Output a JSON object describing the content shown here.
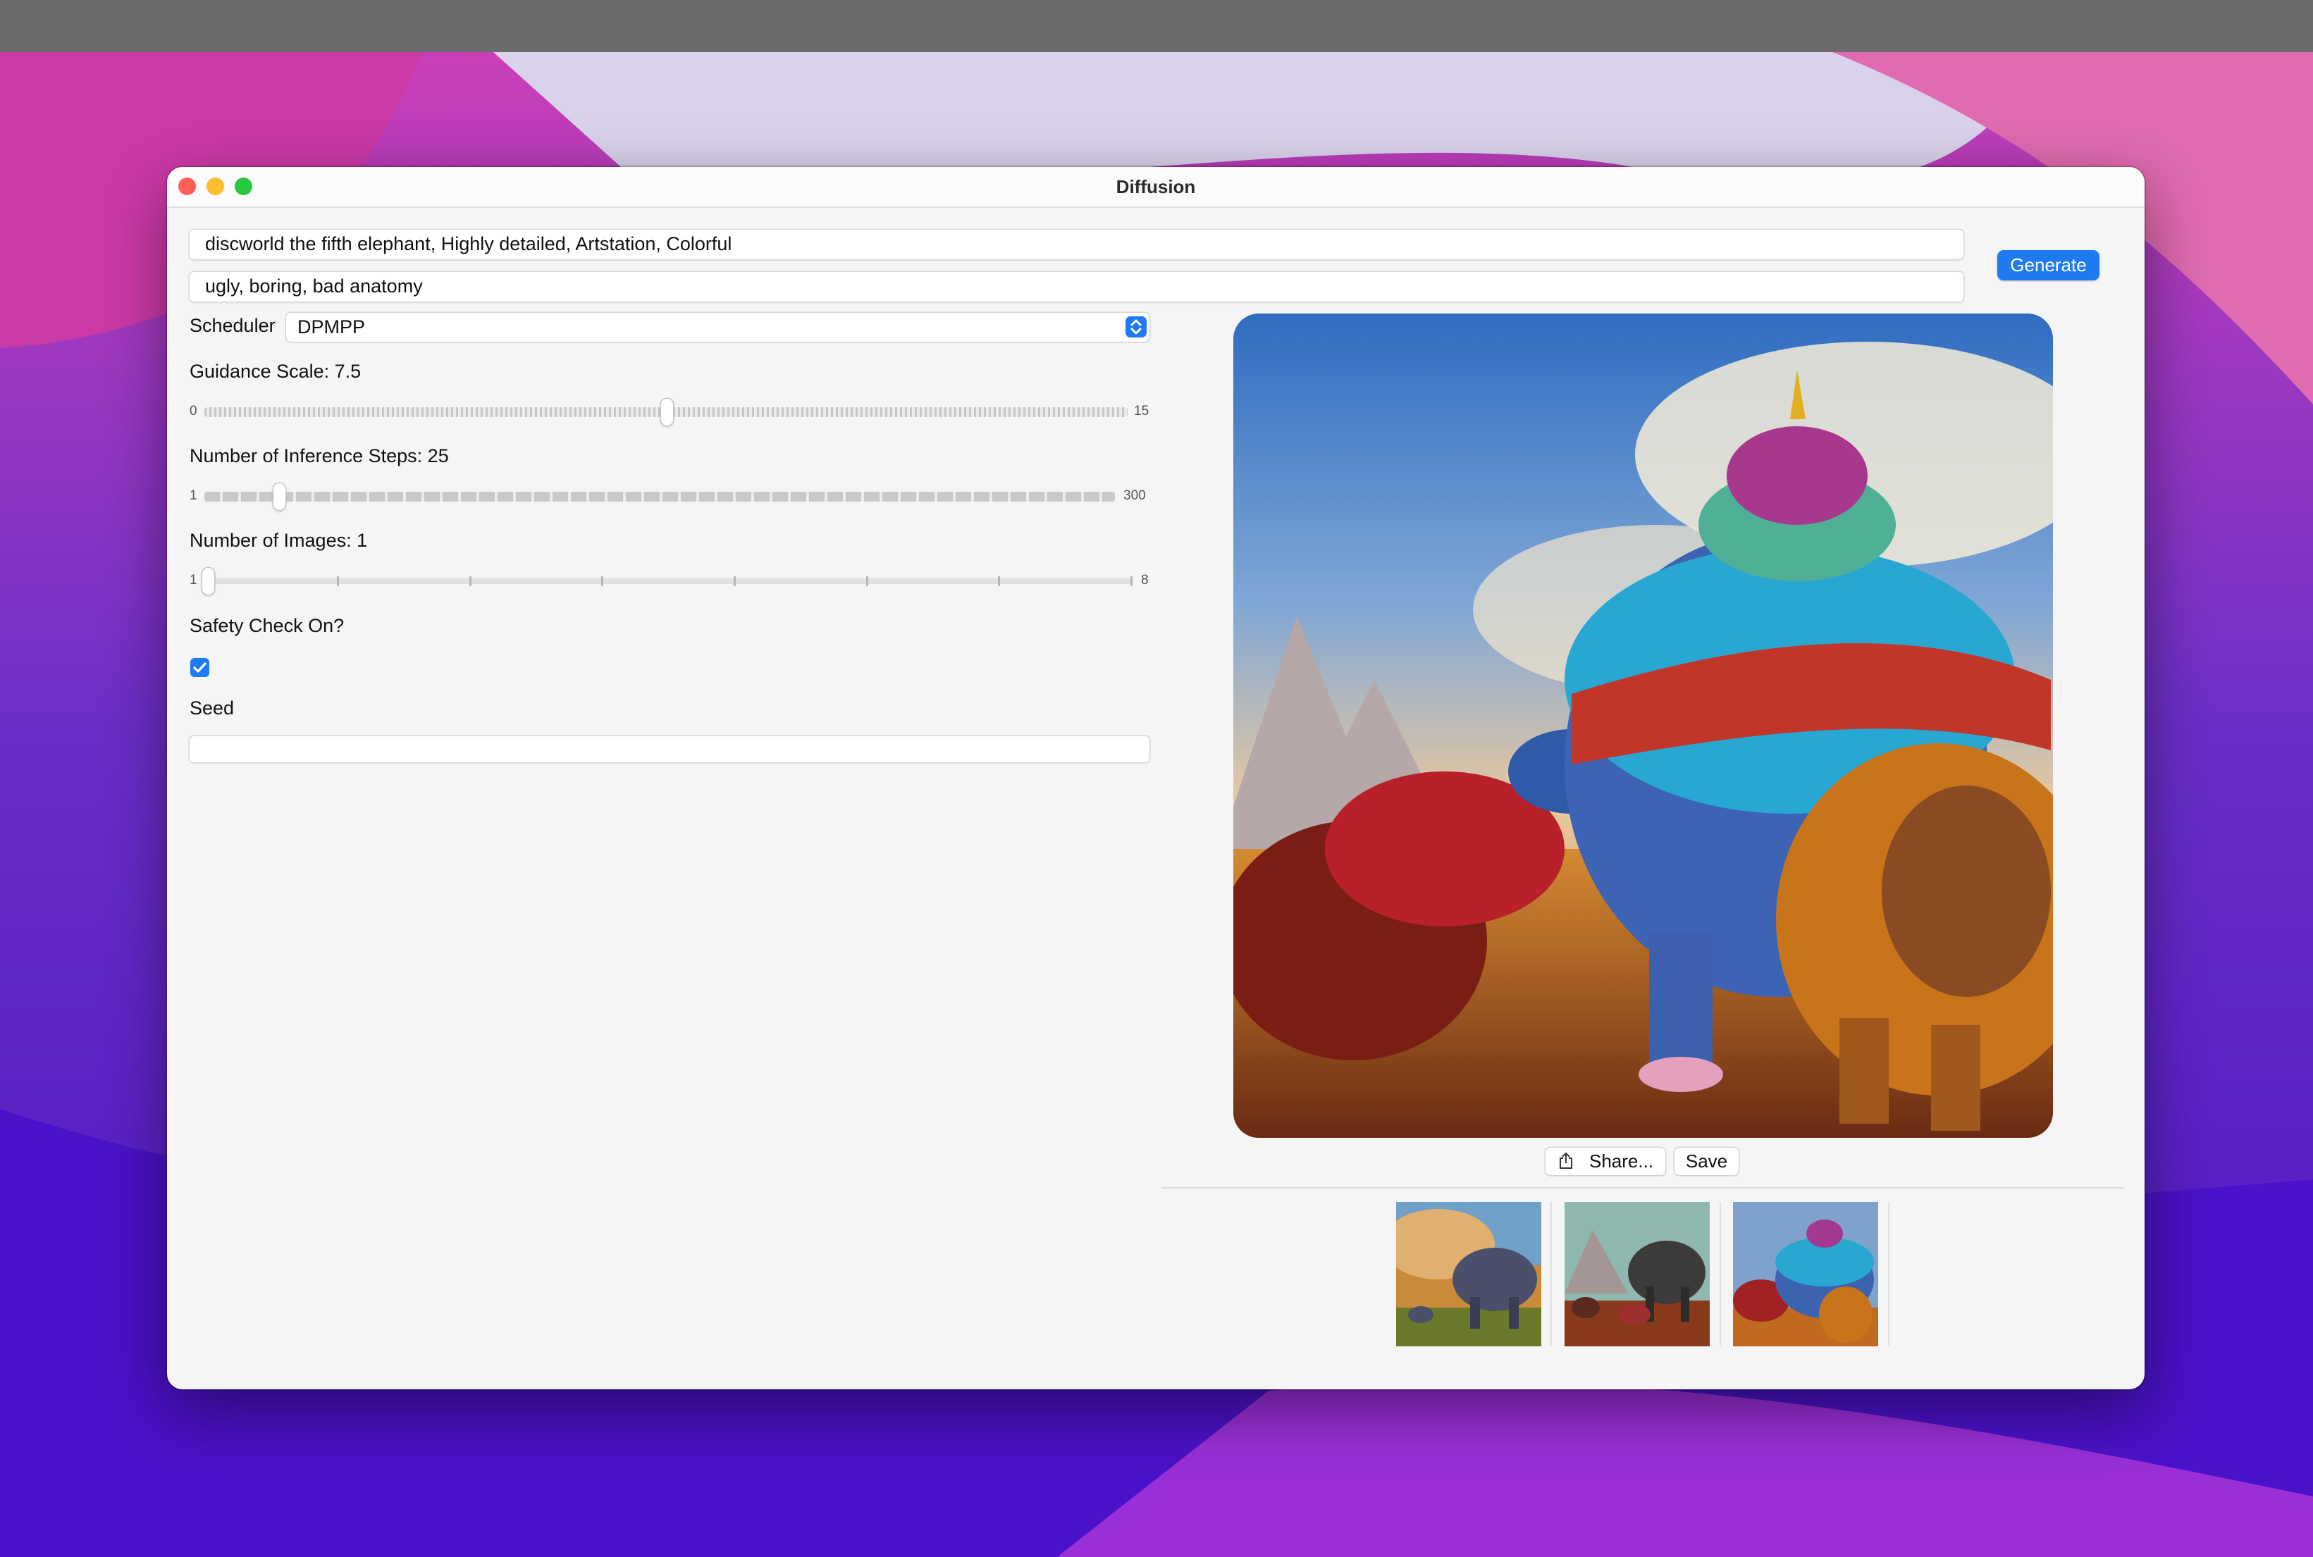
{
  "window": {
    "title": "Diffusion"
  },
  "prompt": {
    "value": "discworld the fifth elephant, Highly detailed, Artstation, Colorful"
  },
  "negative_prompt": {
    "value": "ugly, boring, bad anatomy"
  },
  "generate": {
    "label": "Generate"
  },
  "scheduler": {
    "label": "Scheduler",
    "value": "DPMPP"
  },
  "guidance": {
    "label": "Guidance Scale: 7.5",
    "min": "0",
    "max": "15",
    "value": 7.5
  },
  "steps": {
    "label": "Number of Inference Steps: 25",
    "min": "1",
    "max": "300",
    "value": 25
  },
  "images": {
    "label": "Number of Images: 1",
    "min": "1",
    "max": "8",
    "value": 1
  },
  "safety": {
    "label": "Safety Check On?",
    "checked": true
  },
  "seed": {
    "label": "Seed",
    "value": ""
  },
  "actions": {
    "share": "Share...",
    "save": "Save"
  },
  "colors": {
    "accent": "#1f7bf2",
    "close": "#fe5f57",
    "minimize": "#febc2e",
    "zoom": "#28c840"
  },
  "icons": {
    "share": "share-icon",
    "select": "chevron-up-down-icon",
    "check": "checkmark-icon"
  }
}
